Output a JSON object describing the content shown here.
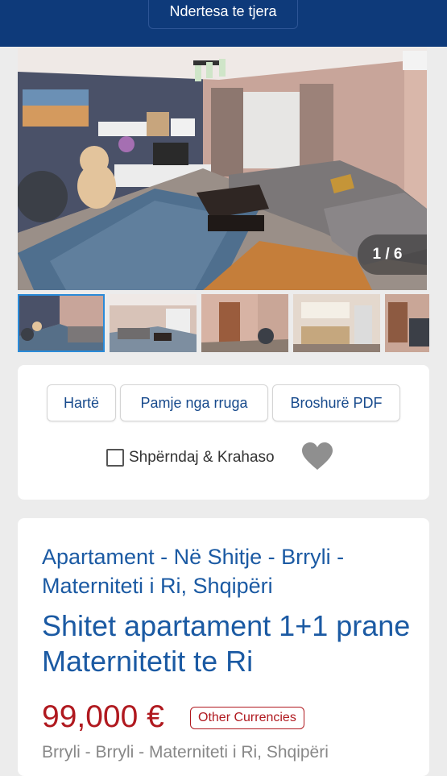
{
  "header": {
    "tab_label": "Ndertesa te tjera",
    "bg_color": "#0e3a7a"
  },
  "gallery": {
    "counter": "1 / 6",
    "thumbnail_count": 5,
    "active_index": 0
  },
  "actions": {
    "buttons": [
      "Hartë",
      "Pamje nga rruga",
      "Broshurë PDF"
    ],
    "compare_label": "Shpërndaj & Krahaso",
    "compare_checked": false,
    "favorite_icon": "heart-icon"
  },
  "listing": {
    "category_title": "Apartament - Në Shitje - Brryli - Materniteti i Ri, Shqipëri",
    "title": "Shitet apartament 1+1 prane Maternitetit te Ri",
    "price": "99,000 €",
    "currencies_label": "Other Currencies",
    "location": "Brryli - Brryli - Materniteti i Ri, Shqipëri",
    "title_color": "#1b5aa3",
    "price_color": "#b0191f"
  }
}
